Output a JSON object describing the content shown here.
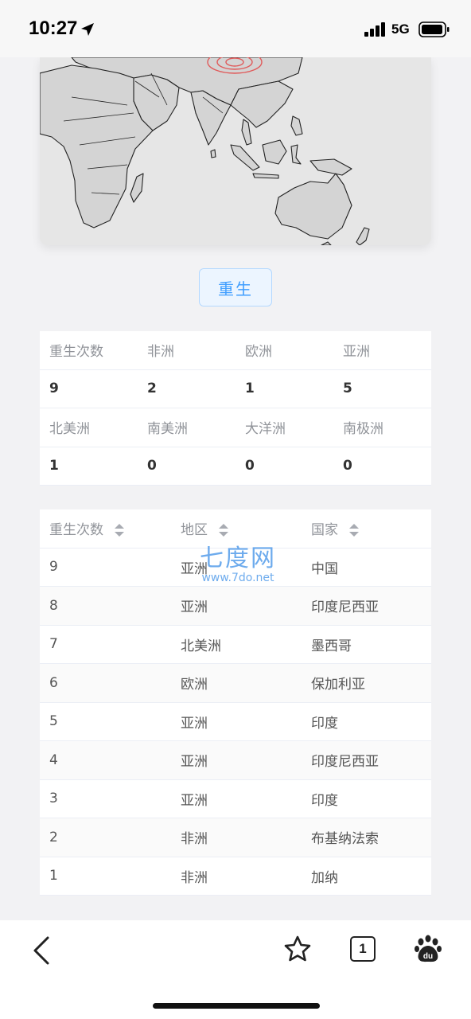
{
  "status": {
    "time": "10:27",
    "network": "5G"
  },
  "action": {
    "rebirth_label": "重生"
  },
  "stats": {
    "rows": [
      {
        "type": "label",
        "cells": [
          "重生次数",
          "非洲",
          "欧洲",
          "亚洲"
        ]
      },
      {
        "type": "value",
        "cells": [
          "9",
          "2",
          "1",
          "5"
        ]
      },
      {
        "type": "label",
        "cells": [
          "北美洲",
          "南美洲",
          "大洋洲",
          "南极洲"
        ]
      },
      {
        "type": "value",
        "cells": [
          "1",
          "0",
          "0",
          "0"
        ]
      }
    ]
  },
  "table": {
    "headers": [
      "重生次数",
      "地区",
      "国家"
    ],
    "rows": [
      [
        "9",
        "亚洲",
        "中国"
      ],
      [
        "8",
        "亚洲",
        "印度尼西亚"
      ],
      [
        "7",
        "北美洲",
        "墨西哥"
      ],
      [
        "6",
        "欧洲",
        "保加利亚"
      ],
      [
        "5",
        "亚洲",
        "印度"
      ],
      [
        "4",
        "亚洲",
        "印度尼西亚"
      ],
      [
        "3",
        "亚洲",
        "印度"
      ],
      [
        "2",
        "非洲",
        "布基纳法索"
      ],
      [
        "1",
        "非洲",
        "加纳"
      ]
    ]
  },
  "watermark": {
    "main": "七度网",
    "sub": "www.7do.net"
  },
  "browser": {
    "tab_count": "1"
  },
  "colors": {
    "accent": "#409eff",
    "marker": "#e05a5a"
  }
}
